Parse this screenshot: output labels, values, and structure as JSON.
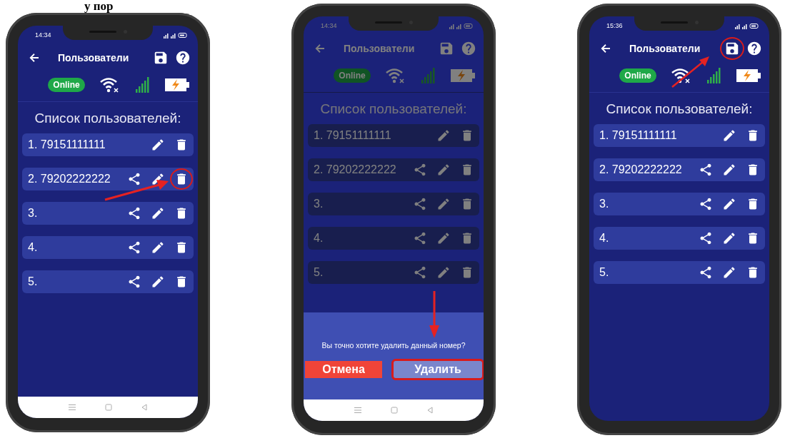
{
  "page_heading": "у пор",
  "phones": [
    {
      "time": "14:34",
      "title": "Пользователи",
      "connection": "Online",
      "list_heading": "Список пользователей:",
      "dimmed": false,
      "nav_bar": true,
      "save_circled": false,
      "users": [
        {
          "label": "1. 79151111111",
          "share": false,
          "delete_circled": false
        },
        {
          "label": "2. 79202222222",
          "share": true,
          "delete_circled": true
        },
        {
          "label": "3.",
          "share": true,
          "delete_circled": false
        },
        {
          "label": "4.",
          "share": true,
          "delete_circled": false
        },
        {
          "label": "5.",
          "share": true,
          "delete_circled": false
        }
      ]
    },
    {
      "time": "14:34",
      "title": "Пользователи",
      "connection": "Online",
      "list_heading": "Список пользователей:",
      "dimmed": true,
      "nav_bar": true,
      "save_circled": false,
      "users": [
        {
          "label": "1. 79151111111",
          "share": false,
          "delete_circled": false
        },
        {
          "label": "2. 79202222222",
          "share": true,
          "delete_circled": false
        },
        {
          "label": "3.",
          "share": true,
          "delete_circled": false
        },
        {
          "label": "4.",
          "share": true,
          "delete_circled": false
        },
        {
          "label": "5.",
          "share": true,
          "delete_circled": false
        }
      ],
      "dialog": {
        "message": "Вы точно хотите удалить данный номер?",
        "cancel": "Отмена",
        "confirm": "Удалить",
        "confirm_circled": true
      }
    },
    {
      "time": "15:36",
      "title": "Пользователи",
      "connection": "Online",
      "list_heading": "Список пользователей:",
      "dimmed": false,
      "nav_bar": false,
      "save_circled": true,
      "users": [
        {
          "label": "1. 79151111111",
          "share": false,
          "delete_circled": false
        },
        {
          "label": "2. 79202222222",
          "share": true,
          "delete_circled": false
        },
        {
          "label": "3.",
          "share": true,
          "delete_circled": false
        },
        {
          "label": "4.",
          "share": true,
          "delete_circled": false
        },
        {
          "label": "5.",
          "share": true,
          "delete_circled": false
        }
      ]
    }
  ]
}
